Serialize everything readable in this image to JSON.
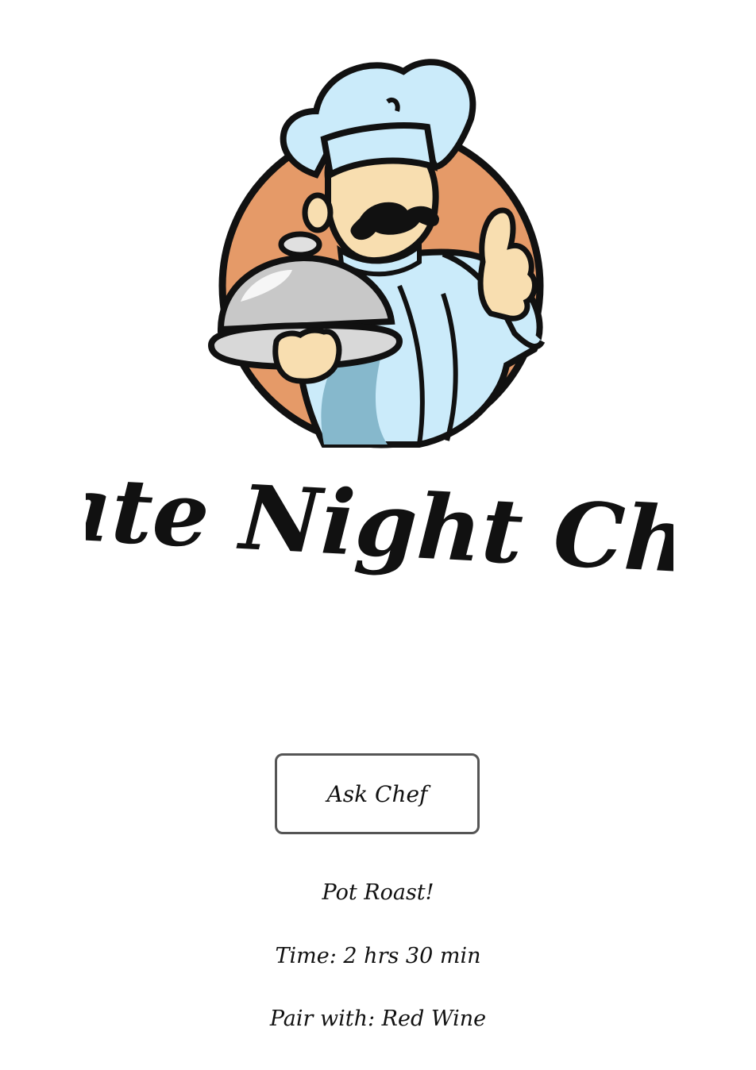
{
  "logo": {
    "title": "Date Night Chef",
    "colors": {
      "badge": "#E59A68",
      "uniform": "#CBEBFA",
      "uniform_shadow": "#86B8CC",
      "skin": "#F8DEB0",
      "cloche": "#C8C8C8",
      "outline": "#111111"
    }
  },
  "actions": {
    "ask_label": "Ask Chef"
  },
  "result": {
    "dish": "Pot Roast!",
    "time": "Time: 2 hrs 30 min",
    "pairing": "Pair with: Red Wine"
  }
}
